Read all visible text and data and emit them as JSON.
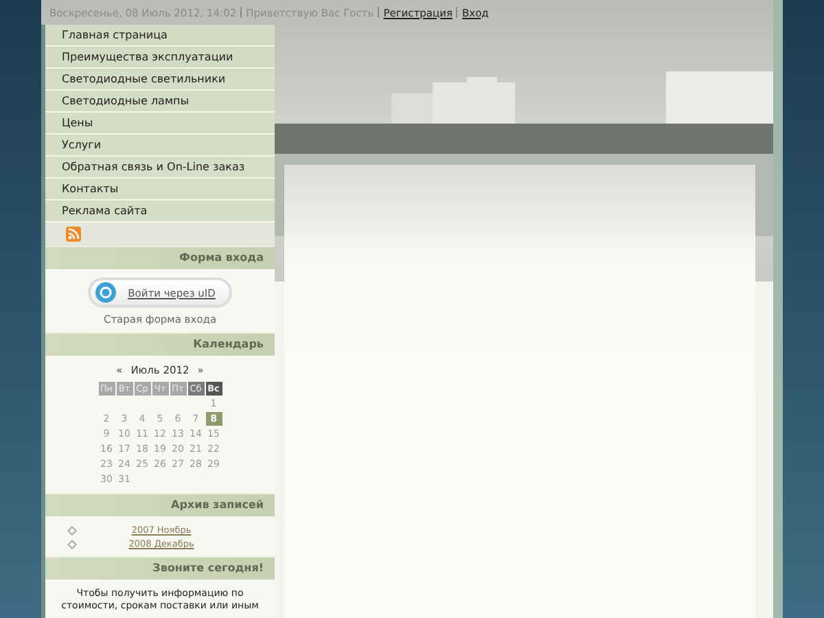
{
  "top_bar": {
    "date": "Воскресенье, 08 Июль 2012, 14:02",
    "greeting": "Приветствую Вас Гость",
    "links": [
      "Регистрация",
      "Вход"
    ]
  },
  "menu": [
    {
      "label": "Главная страница"
    },
    {
      "label": "Преимущества эксплуатации"
    },
    {
      "label": "Светодиодные светильники"
    },
    {
      "label": "Светодиодные лампы"
    },
    {
      "label": "Цены"
    },
    {
      "label": "Услуги"
    },
    {
      "label": "Обратная связь и On-Line заказ"
    },
    {
      "label": "Контакты"
    },
    {
      "label": "Реклама сайта"
    }
  ],
  "login": {
    "title": "Форма входа",
    "uid_button": "Войти через uID",
    "old_form": "Старая форма входа"
  },
  "calendar": {
    "title": "Календарь",
    "prev": "«",
    "month": "Июль 2012",
    "next": "»",
    "weekdays": [
      {
        "label": "Пн",
        "weekend": false,
        "today": false
      },
      {
        "label": "Вт",
        "weekend": false,
        "today": false
      },
      {
        "label": "Ср",
        "weekend": false,
        "today": false
      },
      {
        "label": "Чт",
        "weekend": false,
        "today": false
      },
      {
        "label": "Пт",
        "weekend": false,
        "today": false
      },
      {
        "label": "Сб",
        "weekend": true,
        "today": false
      },
      {
        "label": "Вс",
        "weekend": true,
        "today": true
      }
    ],
    "weeks": [
      {
        "kind": "leading",
        "days": [
          {
            "day": "1",
            "selected": false
          }
        ]
      },
      {
        "kind": "full",
        "days": [
          {
            "day": "2",
            "selected": false
          },
          {
            "day": "3",
            "selected": false
          },
          {
            "day": "4",
            "selected": false
          },
          {
            "day": "5",
            "selected": false
          },
          {
            "day": "6",
            "selected": false
          },
          {
            "day": "7",
            "selected": false
          },
          {
            "day": "8",
            "selected": true
          }
        ]
      },
      {
        "kind": "full",
        "days": [
          {
            "day": "9",
            "selected": false
          },
          {
            "day": "10",
            "selected": false
          },
          {
            "day": "11",
            "selected": false
          },
          {
            "day": "12",
            "selected": false
          },
          {
            "day": "13",
            "selected": false
          },
          {
            "day": "14",
            "selected": false
          },
          {
            "day": "15",
            "selected": false
          }
        ]
      },
      {
        "kind": "full",
        "days": [
          {
            "day": "16",
            "selected": false
          },
          {
            "day": "17",
            "selected": false
          },
          {
            "day": "18",
            "selected": false
          },
          {
            "day": "19",
            "selected": false
          },
          {
            "day": "20",
            "selected": false
          },
          {
            "day": "21",
            "selected": false
          },
          {
            "day": "22",
            "selected": false
          }
        ]
      },
      {
        "kind": "full",
        "days": [
          {
            "day": "23",
            "selected": false
          },
          {
            "day": "24",
            "selected": false
          },
          {
            "day": "25",
            "selected": false
          },
          {
            "day": "26",
            "selected": false
          },
          {
            "day": "27",
            "selected": false
          },
          {
            "day": "28",
            "selected": false
          },
          {
            "day": "29",
            "selected": false
          }
        ]
      },
      {
        "kind": "trailing",
        "days": [
          {
            "day": "30",
            "selected": false
          },
          {
            "day": "31",
            "selected": false
          }
        ]
      }
    ]
  },
  "archive": {
    "title": "Архив записей",
    "items": [
      "2007 Ноябрь",
      "2008 Декабрь"
    ]
  },
  "call": {
    "title": "Звоните сегодня!",
    "text": "Чтобы получить информацию по стоимости, срокам поставки или иным"
  }
}
